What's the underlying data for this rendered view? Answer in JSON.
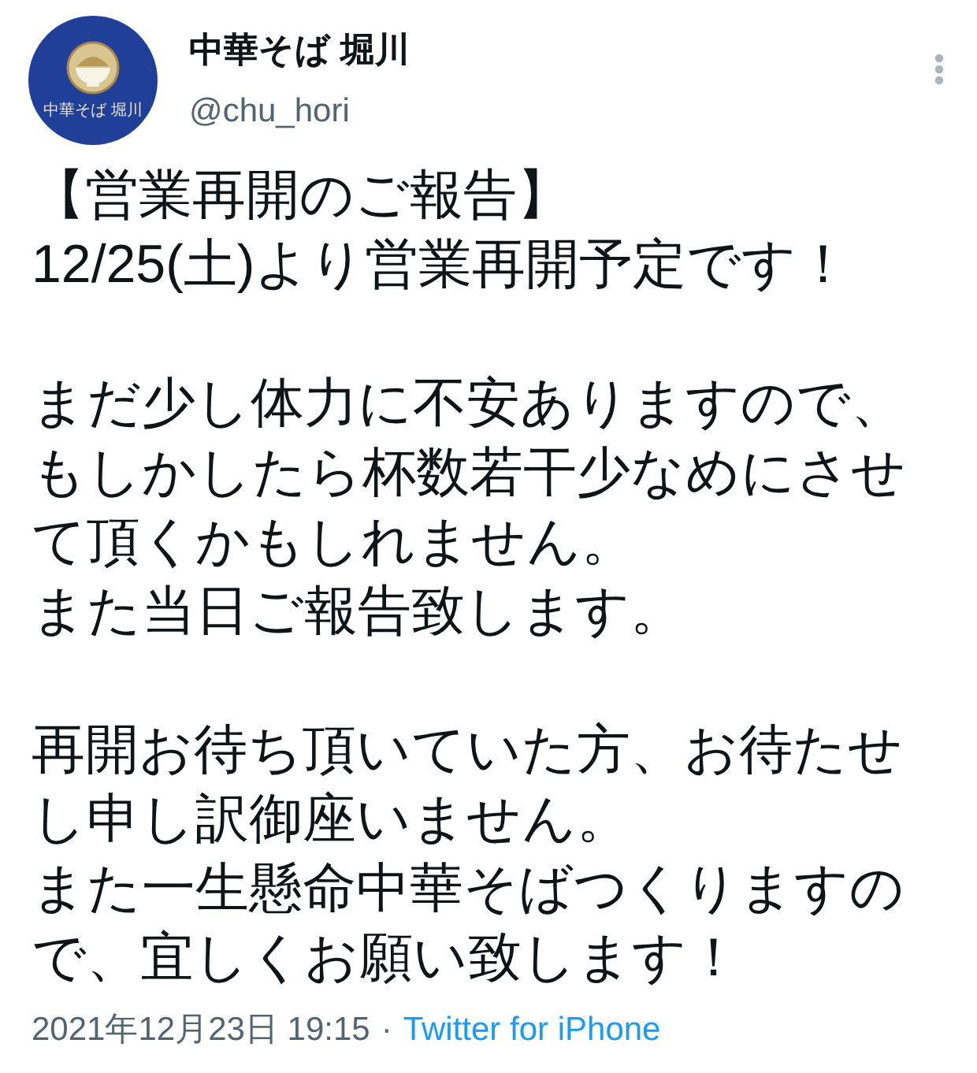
{
  "author": {
    "avatar": {
      "logo_text": "中華そば 堀川"
    },
    "display_name": "中華そば 堀川",
    "handle": "@chu_hori"
  },
  "body": {
    "paragraphs": [
      [
        "【営業再開のご報告】",
        "12/25(土)より営業再開予定です！"
      ],
      [
        "まだ少し体力に不安ありますので、",
        "もしかしたら杯数若干少なめにさせて頂くかもしれません。",
        "また当日ご報告致します。"
      ],
      [
        "再開お待ち頂いていた方、お待たせし申し訳御座いません。",
        "また一生懸命中華そばつくりますので、宜しくお願い致します！"
      ]
    ]
  },
  "footer": {
    "timestamp": "2021年12月23日 19:15",
    "separator": "·",
    "source": "Twitter for iPhone"
  }
}
